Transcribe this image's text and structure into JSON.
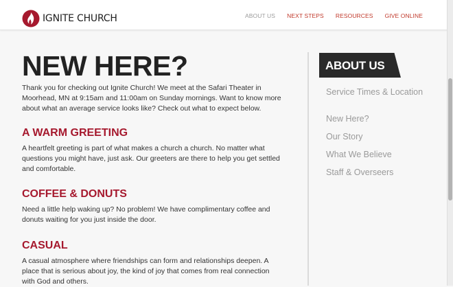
{
  "header": {
    "logo_text": "IGNITE CHURCH",
    "nav": [
      {
        "label": "ABOUT US"
      },
      {
        "label": "NEXT STEPS"
      },
      {
        "label": "RESOURCES"
      },
      {
        "label": "GIVE ONLINE"
      }
    ]
  },
  "main": {
    "title": "NEW HERE?",
    "intro": "Thank you for checking out Ignite Church! We meet at the Safari Theater in Moorhead, MN at 9:15am and 11:00am on Sunday mornings. Want to know more about what an average service looks like? Check out what to expect below.",
    "sections": [
      {
        "heading": "A WARM GREETING",
        "text": "A heartfelt greeting is part of what makes a church a church. No matter what questions you might have, just ask. Our greeters are there to help you get settled and comfortable."
      },
      {
        "heading": "COFFEE & DONUTS",
        "text": "Need a little help waking up? No problem! We have complimentary coffee and donuts waiting for you just inside the door."
      },
      {
        "heading": "CASUAL",
        "text": "A casual atmosphere where friendships can form and relationships deepen. A place that is serious about joy, the kind of joy that comes from real connection with God and others."
      }
    ]
  },
  "sidebar": {
    "title": "ABOUT US",
    "items": [
      {
        "label": "Service Times & Location"
      },
      {
        "label": "New Here?"
      },
      {
        "label": "Our Story"
      },
      {
        "label": "What We Believe"
      },
      {
        "label": "Staff & Overseers"
      }
    ]
  },
  "colors": {
    "accent": "#a6192e",
    "nav_active": "#9b9b9b",
    "sidebar_box": "#2a2a2a"
  },
  "icons": {
    "logo": "flame-icon"
  }
}
